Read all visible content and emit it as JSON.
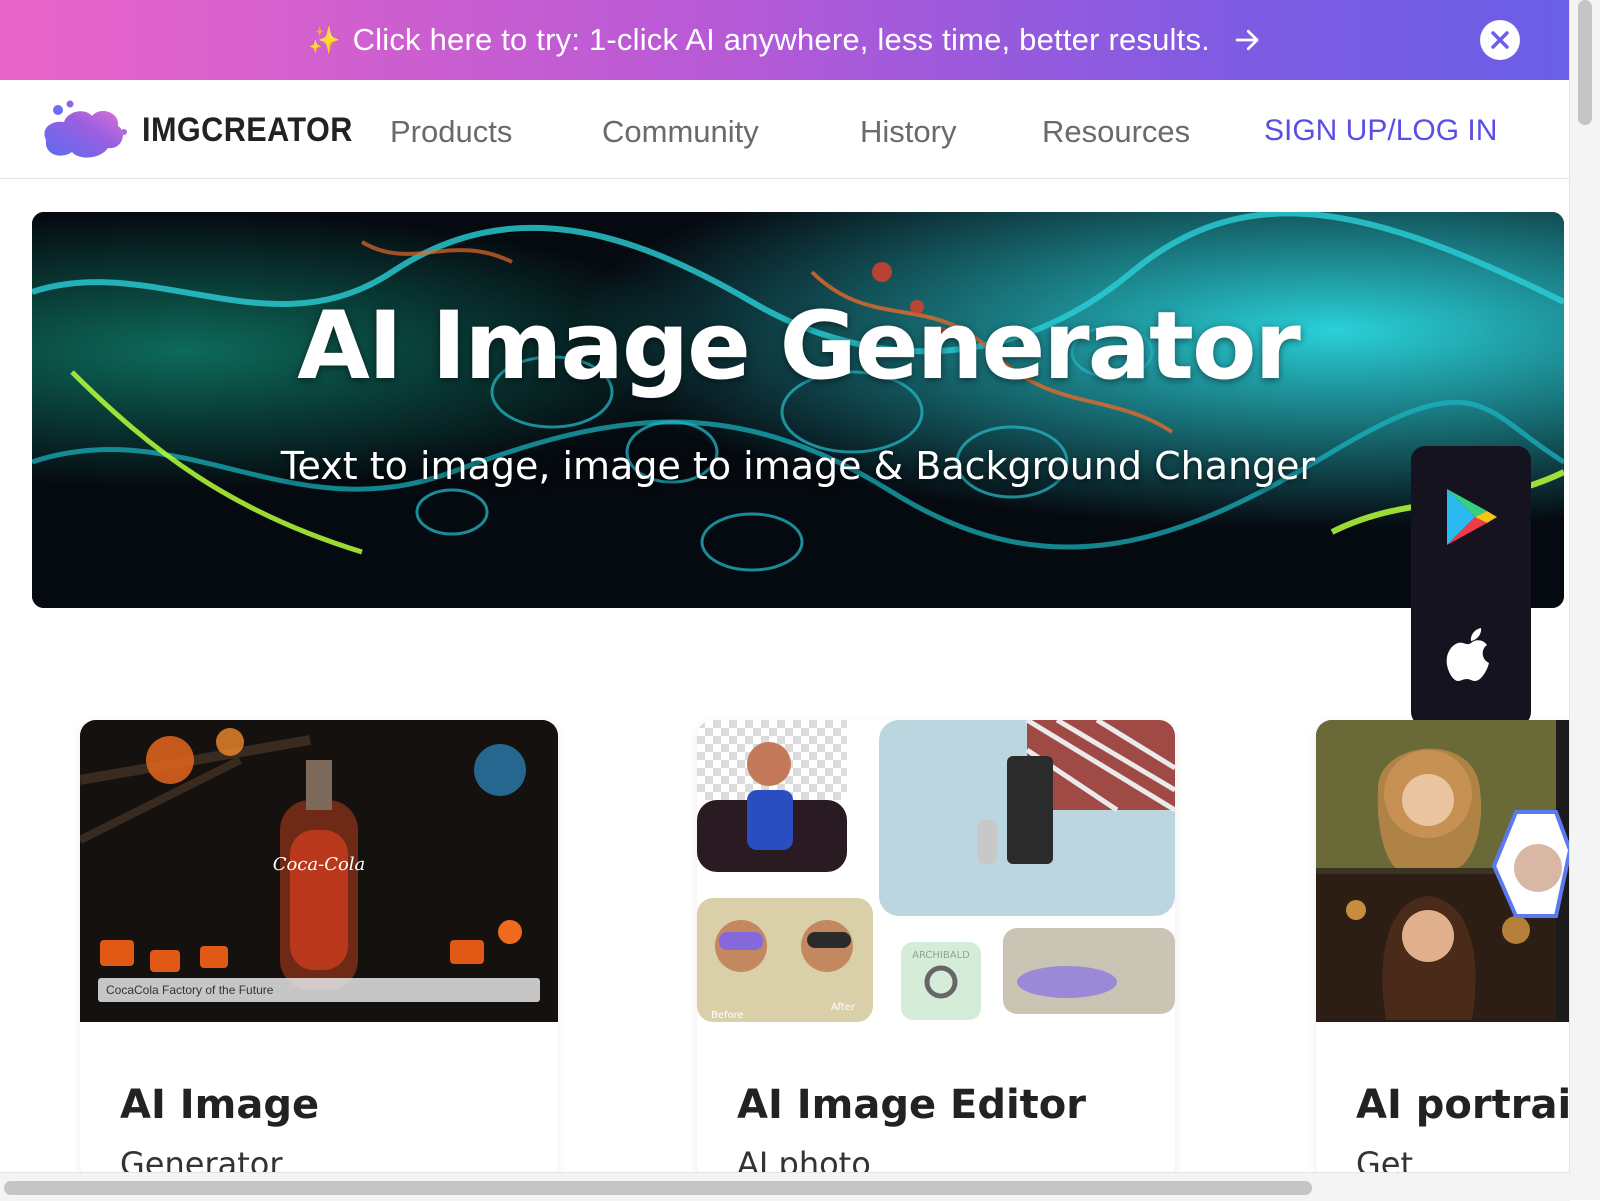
{
  "promo": {
    "text": "Click here to try: 1-click AI anywhere, less time, better results.",
    "spark_icon": "sparkles-icon",
    "arrow_icon": "arrow-right-icon",
    "close_icon": "close-icon"
  },
  "nav": {
    "logo_text": "IMGCREATOR",
    "items": [
      "Products",
      "Community",
      "History",
      "Resources"
    ],
    "signup": "SIGN UP/LOG IN"
  },
  "hero": {
    "title": "AI Image Generator",
    "subtitle": "Text to image, image to image & Background Changer"
  },
  "appbar": {
    "icons": [
      "google-play-icon",
      "apple-icon"
    ]
  },
  "cards": [
    {
      "title": "AI Image",
      "subtitle": "Generator",
      "caption": "CocaCola Factory of the Future"
    },
    {
      "title": "AI Image Editor",
      "subtitle": "AI photo",
      "labels": [
        "Before",
        "After",
        "ARCHIBALD"
      ]
    },
    {
      "title": "AI portrait",
      "subtitle": "Get"
    }
  ],
  "colors": {
    "accent": "#5a4ee6",
    "promo_start": "#e964c8",
    "promo_end": "#6a5fe6"
  }
}
